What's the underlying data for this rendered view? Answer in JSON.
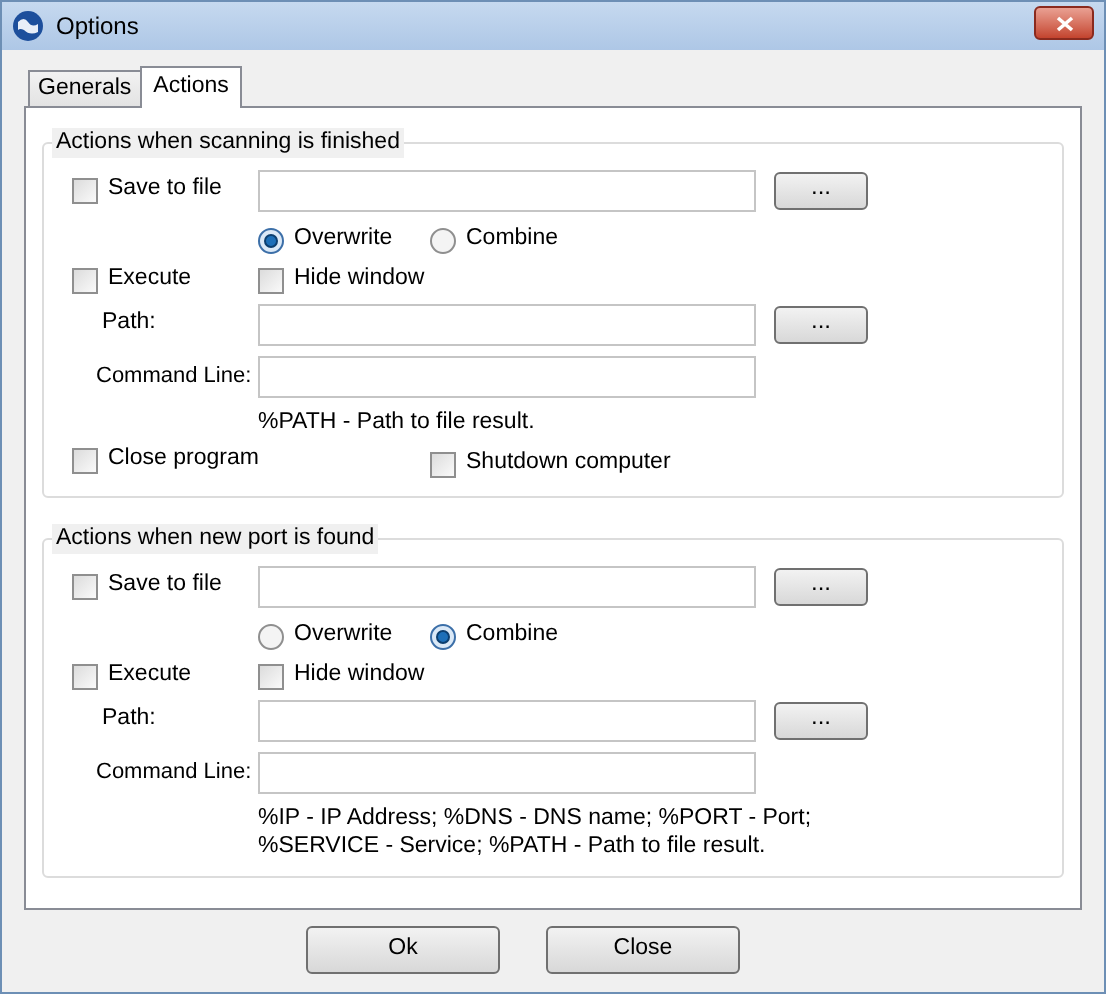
{
  "window": {
    "title": "Options"
  },
  "tabs": [
    {
      "label": "Generals",
      "selected": false
    },
    {
      "label": "Actions",
      "selected": true
    }
  ],
  "groups": [
    {
      "title": "Actions when scanning is finished",
      "save_to_file": {
        "label": "Save to file",
        "checked": false
      },
      "save_browse": "...",
      "write_modes": [
        {
          "label": "Overwrite",
          "selected": true
        },
        {
          "label": "Combine",
          "selected": false
        }
      ],
      "execute": {
        "label": "Execute",
        "checked": false
      },
      "hide_window": {
        "label": "Hide window",
        "checked": false
      },
      "path_label": "Path:",
      "path_browse": "...",
      "command_line_label": "Command Line:",
      "hint_lines": [
        "%PATH - Path to file result."
      ],
      "extra_options": [
        {
          "label": "Close program",
          "checked": false
        },
        {
          "label": "Shutdown computer",
          "checked": false
        }
      ]
    },
    {
      "title": "Actions when new port is found",
      "save_to_file": {
        "label": "Save to file",
        "checked": false
      },
      "save_browse": "...",
      "write_modes": [
        {
          "label": "Overwrite",
          "selected": false
        },
        {
          "label": "Combine",
          "selected": true
        }
      ],
      "execute": {
        "label": "Execute",
        "checked": false
      },
      "hide_window": {
        "label": "Hide window",
        "checked": false
      },
      "path_label": "Path:",
      "path_browse": "...",
      "command_line_label": "Command Line:",
      "hint_lines": [
        "%IP - IP Address; %DNS - DNS name; %PORT - Port;",
        "%SERVICE - Service; %PATH - Path to file result."
      ]
    }
  ],
  "buttons": [
    "Ok",
    "Close"
  ]
}
